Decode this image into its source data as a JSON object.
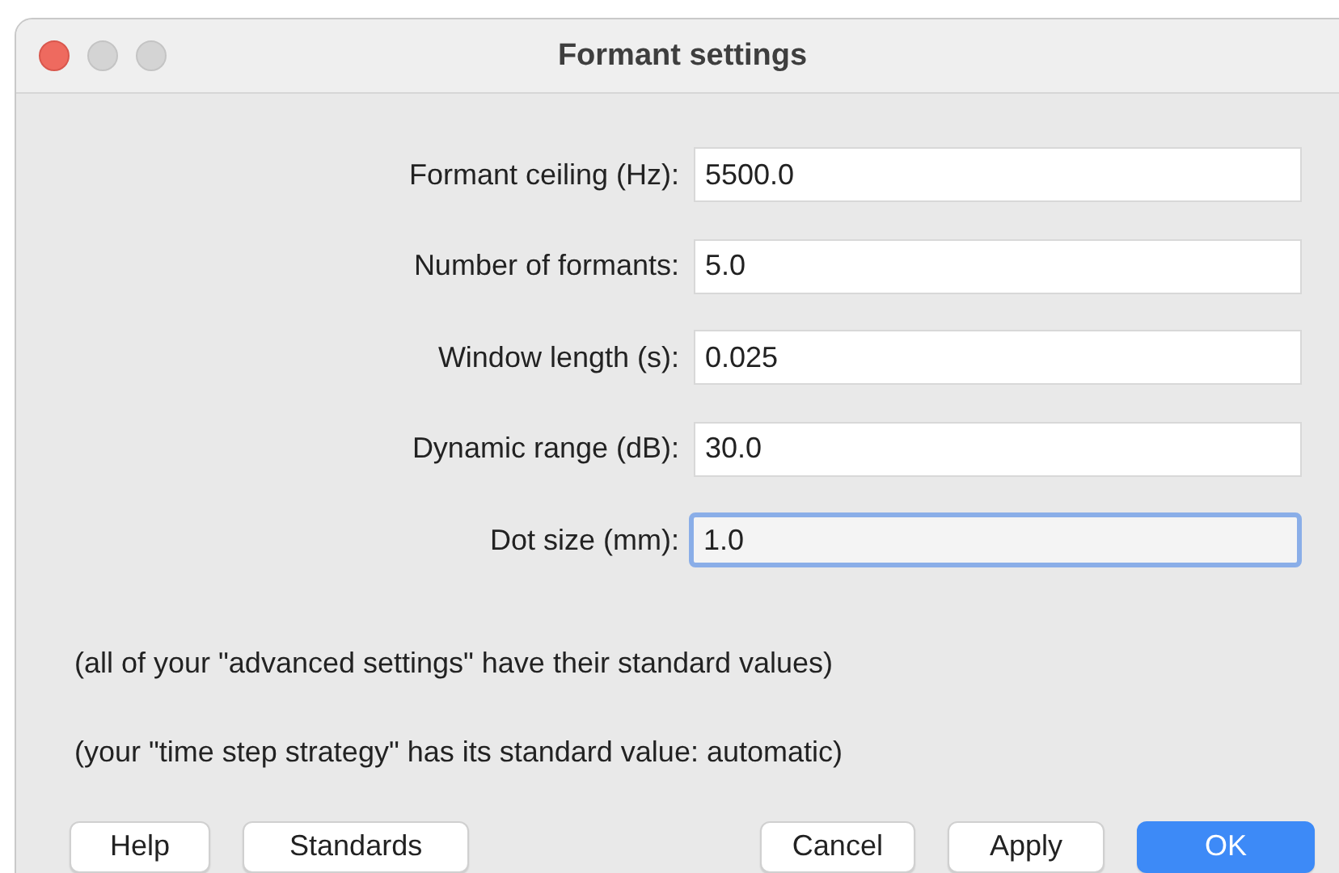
{
  "window": {
    "title": "Formant settings"
  },
  "fields": [
    {
      "label": "Formant ceiling (Hz):",
      "value": "5500.0",
      "focused": false
    },
    {
      "label": "Number of formants:",
      "value": "5.0",
      "focused": false
    },
    {
      "label": "Window length (s):",
      "value": "0.025",
      "focused": false
    },
    {
      "label": "Dynamic range (dB):",
      "value": "30.0",
      "focused": false
    },
    {
      "label": "Dot size (mm):",
      "value": "1.0",
      "focused": true
    }
  ],
  "notes": [
    "(all of your \"advanced settings\" have their standard values)",
    "(your \"time step strategy\" has its standard value: automatic)"
  ],
  "left_buttons": [
    {
      "label": "Help",
      "default": false
    },
    {
      "label": "Standards",
      "default": false
    }
  ],
  "right_buttons": [
    {
      "label": "Cancel",
      "default": false
    },
    {
      "label": "Apply",
      "default": false
    },
    {
      "label": "OK",
      "default": true
    }
  ]
}
